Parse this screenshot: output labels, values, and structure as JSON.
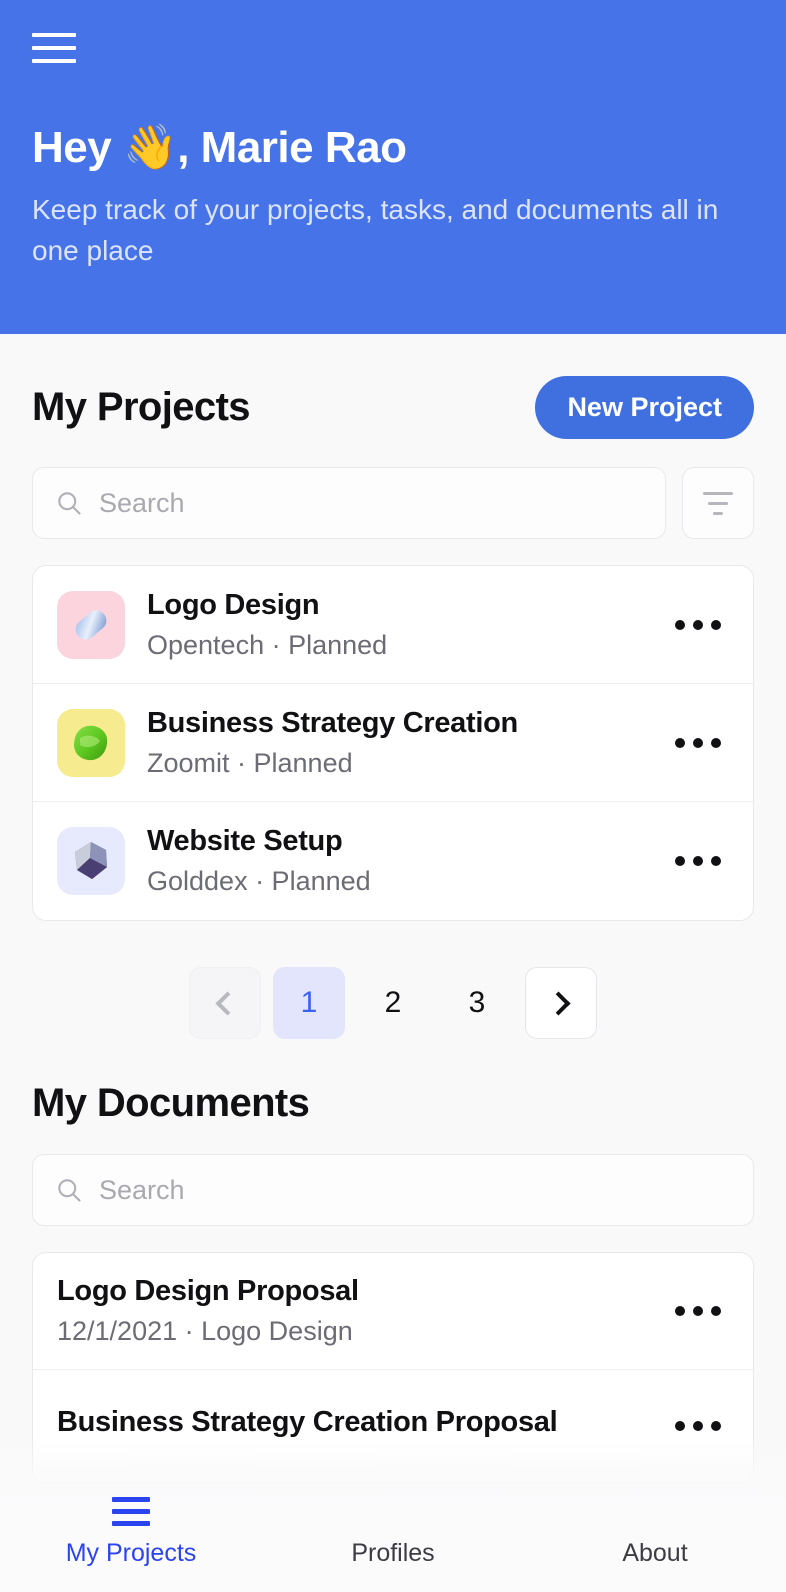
{
  "header": {
    "menu_icon": "hamburger-menu-icon",
    "greeting": "Hey 👋, Marie Rao",
    "subtitle": "Keep track of your projects, tasks, and documents all in one place",
    "bg_color": "#4773e8"
  },
  "projects": {
    "title": "My Projects",
    "new_button": "New Project",
    "search_placeholder": "Search",
    "search_value": "",
    "search_icon": "search-icon",
    "filter_icon": "filter-icon",
    "items": [
      {
        "name": "Logo Design",
        "meta": "Opentech · Planned",
        "client": "Opentech",
        "status": "Planned",
        "thumb_bg": "#fbd4de",
        "thumb_shape": "capsule",
        "thumb_color": "#7d9ad8",
        "menu": "•••"
      },
      {
        "name": "Business Strategy Creation",
        "meta": "Zoomit · Planned",
        "client": "Zoomit",
        "status": "Planned",
        "thumb_bg": "#f7eb8f",
        "thumb_shape": "blob",
        "thumb_color": "#5ec32a",
        "menu": "•••"
      },
      {
        "name": "Website Setup",
        "meta": "Golddex · Planned",
        "client": "Golddex",
        "status": "Planned",
        "thumb_bg": "#e6eafc",
        "thumb_shape": "polygon",
        "thumb_color": "#6a5a9e",
        "menu": "•••"
      }
    ],
    "pagination": {
      "prev_icon": "chevron-left-icon",
      "next_icon": "chevron-right-icon",
      "pages": [
        "1",
        "2",
        "3"
      ],
      "current": "1",
      "active_bg": "#e2e5fb",
      "active_color": "#3b63f0"
    }
  },
  "documents": {
    "title": "My Documents",
    "search_placeholder": "Search",
    "search_value": "",
    "search_icon": "search-icon",
    "items": [
      {
        "name": "Logo Design Proposal",
        "meta": "12/1/2021 · Logo Design",
        "date": "12/1/2021",
        "project": "Logo Design",
        "menu": "•••"
      },
      {
        "name": "Business Strategy Creation Proposal",
        "meta": "",
        "menu": "•••"
      }
    ]
  },
  "bottom_nav": {
    "items": [
      {
        "label": "My Projects",
        "icon": "list-lines-icon",
        "active": true
      },
      {
        "label": "Profiles",
        "icon": "",
        "active": false
      },
      {
        "label": "About",
        "icon": "",
        "active": false
      }
    ],
    "active_color": "#2a44f0"
  }
}
